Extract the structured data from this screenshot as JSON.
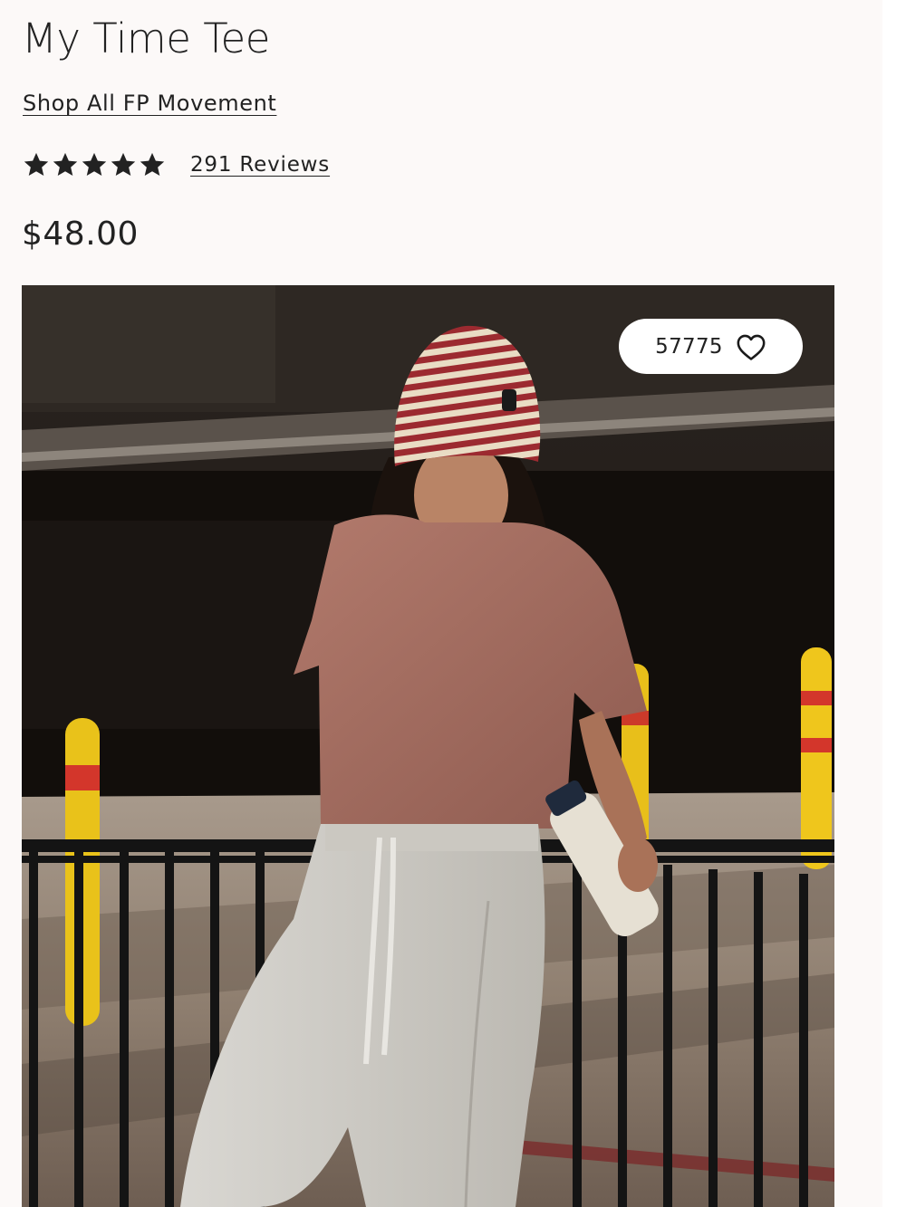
{
  "product": {
    "title": "My Time Tee",
    "collection_link": "Shop All FP Movement",
    "rating": 5,
    "reviews_label": "291 Reviews",
    "price": "$48.00"
  },
  "image": {
    "favorites_count": "57775",
    "favorite_icon": "heart-outline-icon"
  },
  "colors": {
    "text": "#222222",
    "page_background": "#fcf9f8"
  }
}
